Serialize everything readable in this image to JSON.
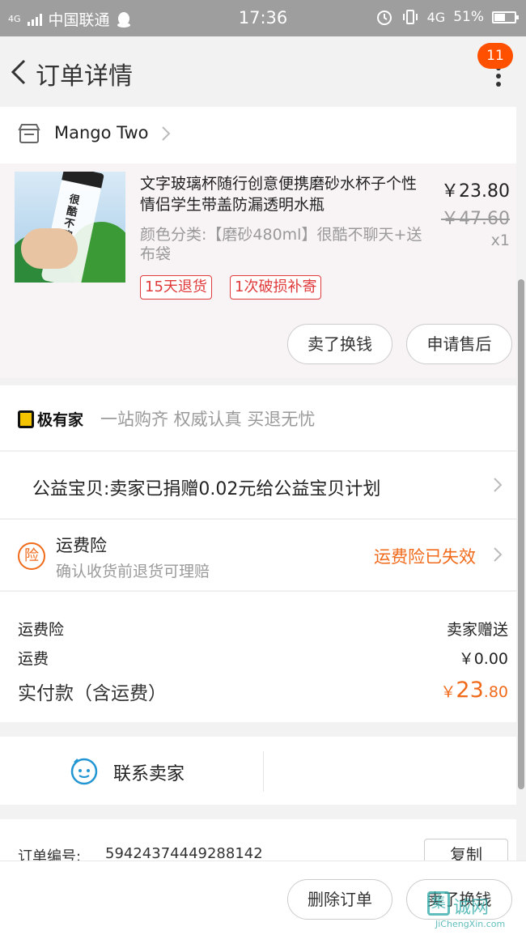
{
  "status_bar": {
    "network_type": "4G",
    "carrier": "中国联通",
    "time": "17:36",
    "data_type": "4G",
    "battery_percent": "51%",
    "battery_level": 0.51
  },
  "nav": {
    "title": "订单详情",
    "badge": "11"
  },
  "shop": {
    "name": "Mango Two"
  },
  "product": {
    "title": "文字玻璃杯随行创意便携磨砂水杯子个性情侣学生带盖防漏透明水瓶",
    "sku": "颜色分类:【磨砂480ml】很酷不聊天+送布袋",
    "price": "￥23.80",
    "original_price": "￥47.60",
    "quantity": "x1",
    "tags": [
      "15天退货",
      "1次破损补寄"
    ],
    "bottle_text": "很酷不聊天",
    "buttons": {
      "sell": "卖了换钱",
      "after_sale": "申请售后"
    }
  },
  "promo": {
    "logo": "极有家",
    "slogan": "一站购齐 权威认真 买退无忧"
  },
  "charity": {
    "text": "公益宝贝:卖家已捐赠0.02元给公益宝贝计划"
  },
  "insurance": {
    "icon_text": "险",
    "name": "运费险",
    "desc": "确认收货前退货可理赔",
    "status": "运费险已失效"
  },
  "summary": {
    "shipping_insurance_label": "运费险",
    "shipping_insurance_value": "卖家赠送",
    "shipping_label": "运费",
    "shipping_value": "￥0.00",
    "total_label": "实付款（含运费）",
    "total_currency": "￥",
    "total_integer": "23",
    "total_decimal": ".80"
  },
  "contact": {
    "label": "联系卖家"
  },
  "order": {
    "number_label": "订单编号:",
    "number": "59424374449288142",
    "copy": "复制"
  },
  "bottom_bar": {
    "delete": "删除订单",
    "sell": "卖了换钱"
  },
  "watermark": {
    "box": "集",
    "cn": "诚网",
    "en": "JiChengXin.com"
  },
  "colors": {
    "accent": "#f06a1a",
    "badge": "#ff5000",
    "tag": "#e03b3b"
  }
}
